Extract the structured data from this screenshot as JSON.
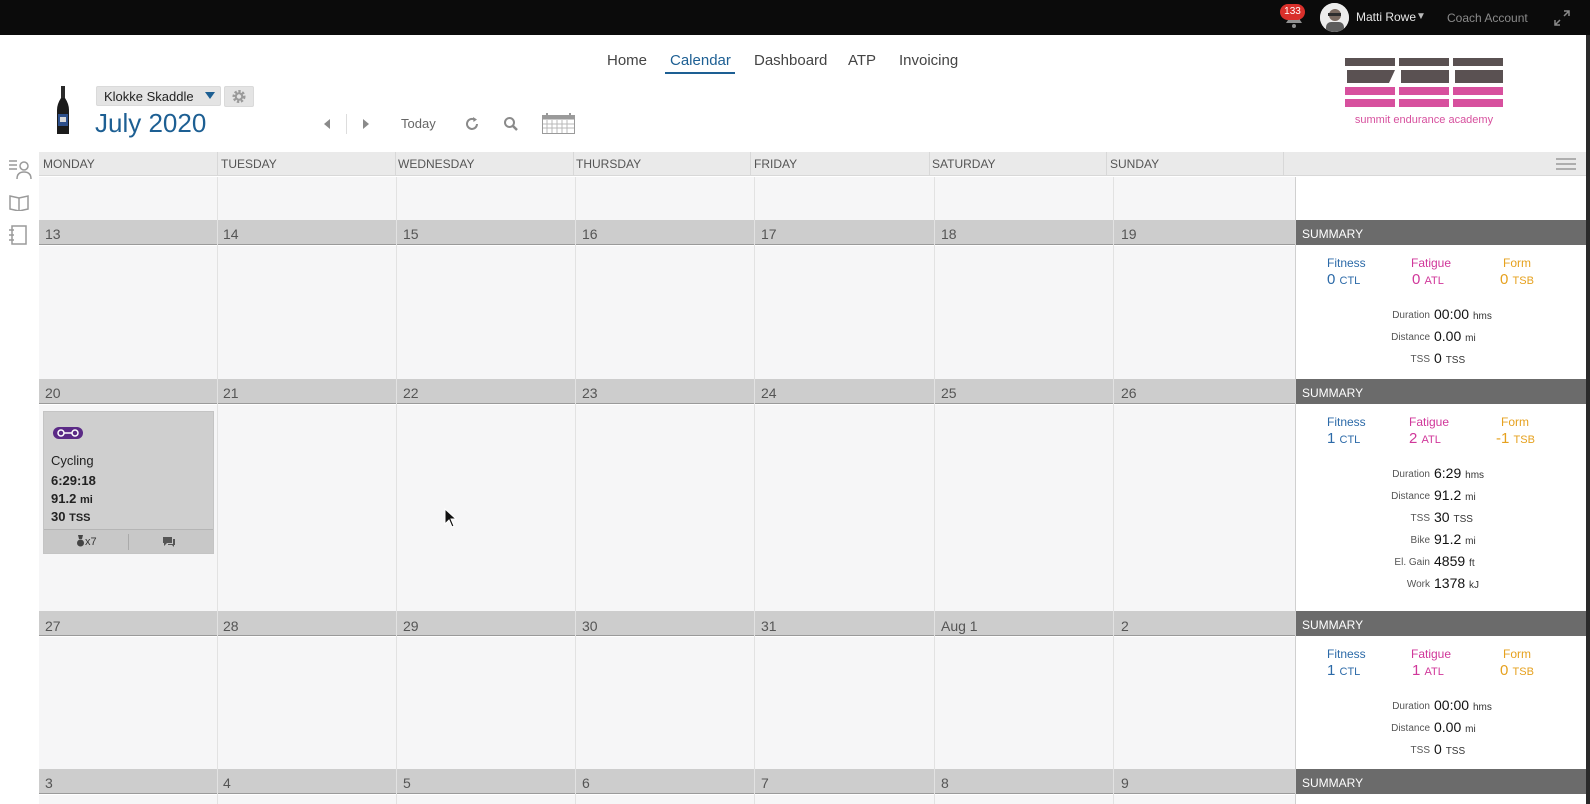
{
  "topbar": {
    "notification_count": "133",
    "user_name": "Matti Rowe",
    "coach_account": "Coach Account"
  },
  "nav": {
    "items": [
      "Home",
      "Calendar",
      "Dashboard",
      "ATP",
      "Invoicing"
    ],
    "active": "Calendar"
  },
  "header": {
    "athlete": "Klokke Skaddle",
    "month_title": "July 2020",
    "today_label": "Today"
  },
  "logo": {
    "text": "summit endurance academy",
    "colors": {
      "dark": "#5a5152",
      "pink": "#d7509e"
    }
  },
  "weekdays": [
    "MONDAY",
    "TUESDAY",
    "WEDNESDAY",
    "THURSDAY",
    "FRIDAY",
    "SATURDAY",
    "SUNDAY"
  ],
  "weeks": [
    {
      "days": [
        "13",
        "14",
        "15",
        "16",
        "17",
        "18",
        "19"
      ],
      "summary": {
        "label": "SUMMARY",
        "fitness": {
          "label": "Fitness",
          "value": "0",
          "unit": "CTL"
        },
        "fatigue": {
          "label": "Fatigue",
          "value": "0",
          "unit": "ATL"
        },
        "form": {
          "label": "Form",
          "value": "0",
          "unit": "TSB"
        },
        "stats": [
          {
            "label": "Duration",
            "value": "00:00",
            "unit": "hms"
          },
          {
            "label": "Distance",
            "value": "0.00",
            "unit": "mi"
          },
          {
            "label": "TSS",
            "value": "0",
            "unit": "TSS"
          }
        ]
      }
    },
    {
      "days": [
        "20",
        "21",
        "22",
        "23",
        "24",
        "25",
        "26"
      ],
      "summary": {
        "label": "SUMMARY",
        "fitness": {
          "label": "Fitness",
          "value": "1",
          "unit": "CTL"
        },
        "fatigue": {
          "label": "Fatigue",
          "value": "2",
          "unit": "ATL"
        },
        "form": {
          "label": "Form",
          "value": "-1",
          "unit": "TSB"
        },
        "stats": [
          {
            "label": "Duration",
            "value": "6:29",
            "unit": "hms"
          },
          {
            "label": "Distance",
            "value": "91.2",
            "unit": "mi"
          },
          {
            "label": "TSS",
            "value": "30",
            "unit": "TSS"
          },
          {
            "label": "Bike",
            "value": "91.2",
            "unit": "mi"
          },
          {
            "label": "El. Gain",
            "value": "4859",
            "unit": "ft"
          },
          {
            "label": "Work",
            "value": "1378",
            "unit": "kJ"
          }
        ]
      }
    },
    {
      "days": [
        "27",
        "28",
        "29",
        "30",
        "31",
        "Aug 1",
        "2"
      ],
      "summary": {
        "label": "SUMMARY",
        "fitness": {
          "label": "Fitness",
          "value": "1",
          "unit": "CTL"
        },
        "fatigue": {
          "label": "Fatigue",
          "value": "1",
          "unit": "ATL"
        },
        "form": {
          "label": "Form",
          "value": "0",
          "unit": "TSB"
        },
        "stats": [
          {
            "label": "Duration",
            "value": "00:00",
            "unit": "hms"
          },
          {
            "label": "Distance",
            "value": "0.00",
            "unit": "mi"
          },
          {
            "label": "TSS",
            "value": "0",
            "unit": "TSS"
          }
        ]
      }
    },
    {
      "days": [
        "3",
        "4",
        "5",
        "6",
        "7",
        "8",
        "9"
      ],
      "summary": {
        "label": "SUMMARY"
      }
    }
  ],
  "workout": {
    "sport": "Cycling",
    "duration": "6:29:18",
    "distance": "91.2",
    "distance_unit": "mi",
    "tss": "30",
    "tss_unit": "TSS",
    "medals": "x7"
  }
}
